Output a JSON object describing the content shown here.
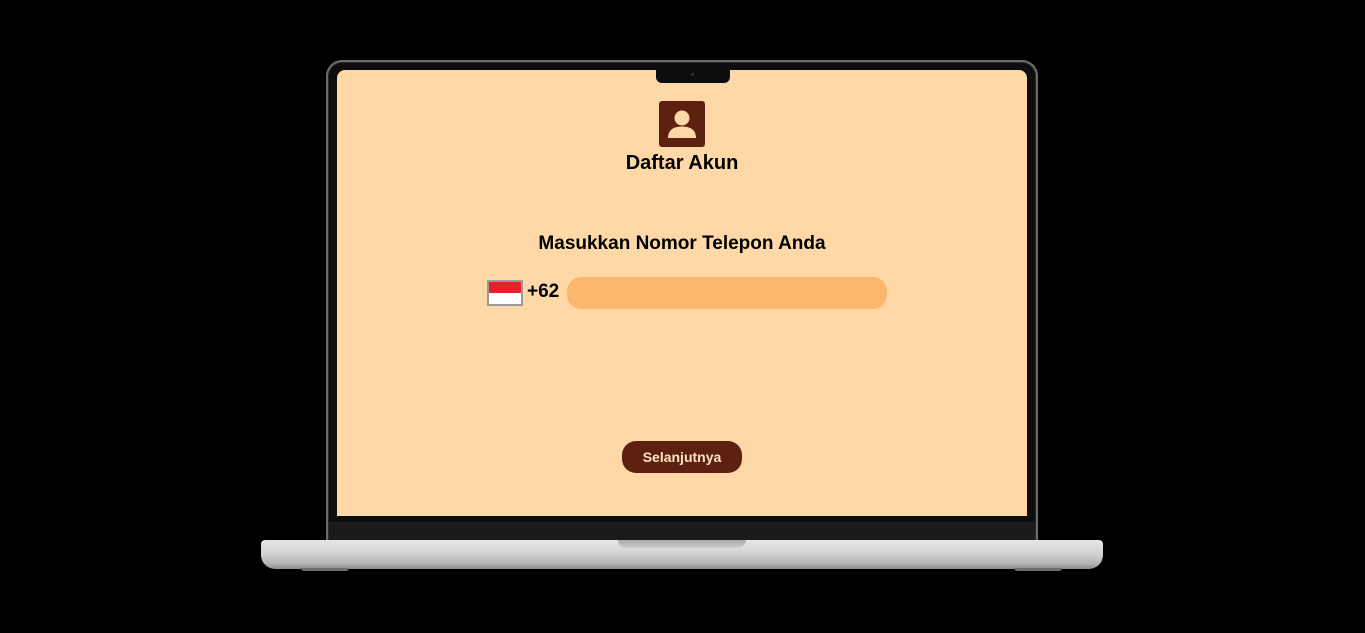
{
  "header": {
    "icon": "user-account-icon",
    "title": "Daftar Akun"
  },
  "form": {
    "prompt": "Masukkan Nomor Telepon Anda",
    "country": {
      "flag": "indonesia-flag-icon",
      "code": "+62"
    },
    "phone_input": {
      "value": "",
      "placeholder": ""
    },
    "next_button_label": "Selanjutnya"
  },
  "colors": {
    "screen_background": "#FFD8A8",
    "accent_brown": "#5C2111",
    "input_fill": "#FBB86D",
    "button_text": "#FFE3C2",
    "flag_red": "#E8202A",
    "flag_white": "#FFFFFF"
  }
}
